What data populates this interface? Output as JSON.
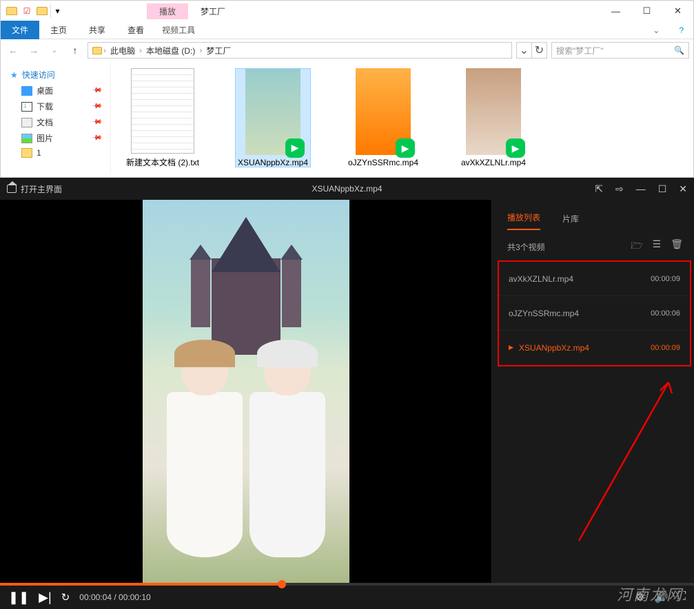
{
  "explorer": {
    "contextual_group": "播放",
    "title": "梦工厂",
    "ribbon": {
      "file": "文件",
      "home": "主页",
      "share": "共享",
      "view": "查看",
      "video_tools": "视频工具"
    },
    "breadcrumb": [
      "此电脑",
      "本地磁盘 (D:)",
      "梦工厂"
    ],
    "search_placeholder": "搜索\"梦工厂\"",
    "sidebar": {
      "quick": "快速访问",
      "items": [
        {
          "label": "桌面"
        },
        {
          "label": "下载"
        },
        {
          "label": "文档"
        },
        {
          "label": "图片"
        },
        {
          "label": "1"
        }
      ]
    },
    "files": [
      {
        "label": "新建文本文档 (2).txt",
        "type": "doc"
      },
      {
        "label": "XSUANppbXz.mp4",
        "type": "vid1",
        "selected": true
      },
      {
        "label": "oJZYnSSRmc.mp4",
        "type": "vid2"
      },
      {
        "label": "avXkXZLNLr.mp4",
        "type": "vid3"
      }
    ]
  },
  "player": {
    "home": "打开主界面",
    "title": "XSUANppbXz.mp4",
    "time_current": "00:00:04",
    "time_total": "00:00:10",
    "playlist": {
      "tab_playlist": "播放列表",
      "tab_library": "片库",
      "count": "共3个视频",
      "items": [
        {
          "name": "avXkXZLNLr.mp4",
          "dur": "00:00:09"
        },
        {
          "name": "oJZYnSSRmc.mp4",
          "dur": "00:00:06"
        },
        {
          "name": "XSUANppbXz.mp4",
          "dur": "00:00:09",
          "active": true
        }
      ]
    }
  },
  "watermark": "河南龙网"
}
